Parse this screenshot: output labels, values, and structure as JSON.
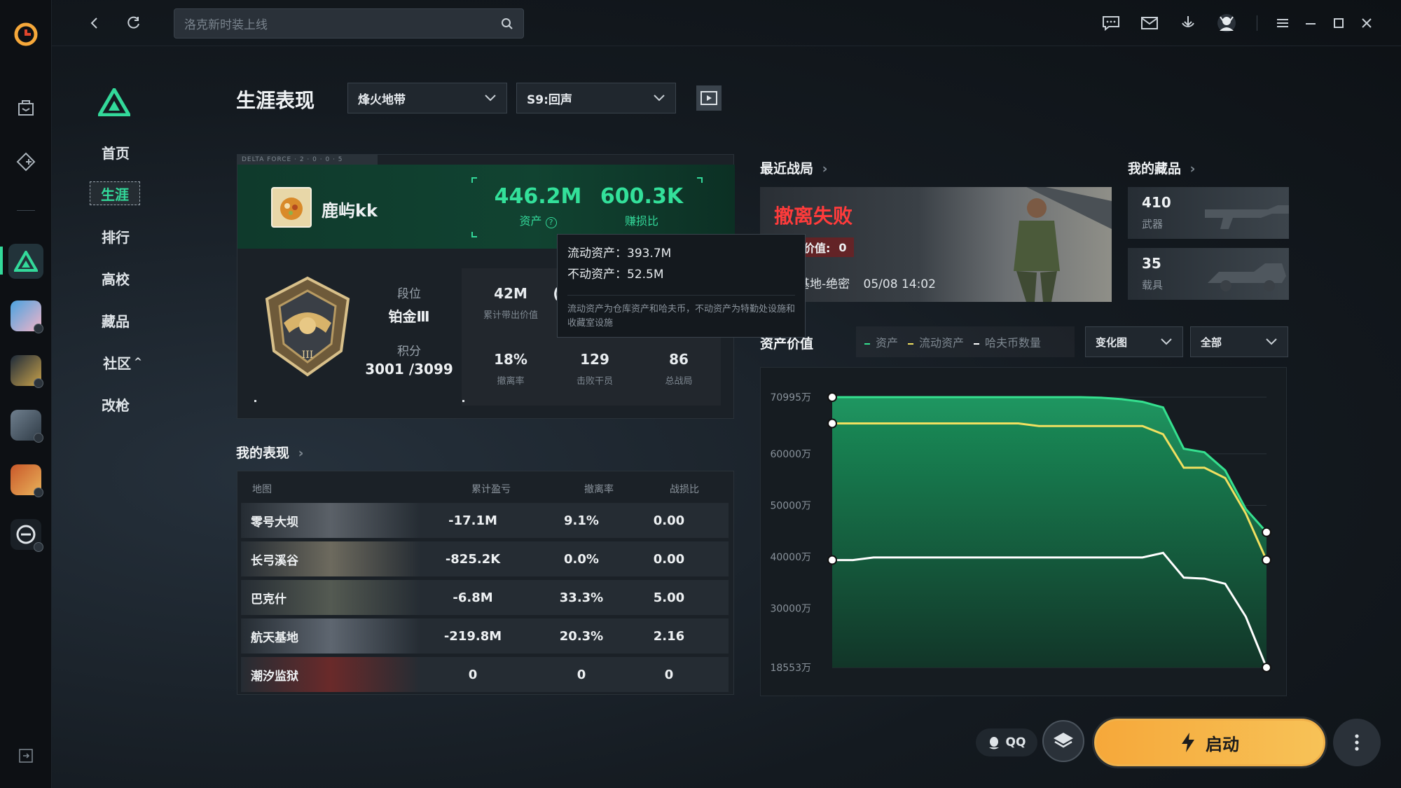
{
  "topbar": {
    "search_placeholder": "洛克新时装上线"
  },
  "left_nav": {
    "items": [
      {
        "label": "首页",
        "active": false
      },
      {
        "label": "生涯",
        "active": true
      },
      {
        "label": "排行",
        "active": false
      },
      {
        "label": "高校",
        "active": false
      },
      {
        "label": "藏品",
        "active": false
      },
      {
        "label": "社区",
        "active": false,
        "chevron": "^"
      },
      {
        "label": "改枪",
        "active": false
      }
    ]
  },
  "career": {
    "title": "生涯表现",
    "mode_dropdown": "烽火地带",
    "season_dropdown": "S9:回声",
    "card_tag": "DELTA FORCE · 2 · 0 · 0 · 5",
    "player_name": "鹿屿kk",
    "assets_value": "446.2M",
    "assets_label": "资产",
    "profit_value": "600.3K",
    "profit_label": "赚损比",
    "rank_label": "段位",
    "rank_value": "铂金Ⅲ",
    "points_label": "积分",
    "points_value": "3001 /3099",
    "stats": [
      {
        "value": "42M",
        "label": "累计带出价值"
      },
      {
        "value": "18%",
        "label": "撤离率"
      },
      {
        "value": "129",
        "label": "击败干员"
      },
      {
        "value": "86",
        "label": "总战局"
      }
    ],
    "stat_hidden_fragment": "(",
    "tooltip": {
      "liquid": "流动资产：393.7M",
      "fixed": "不动资产：52.5M",
      "note": "流动资产为仓库资产和哈夫币，不动资产为特勤处设施和收藏室设施"
    }
  },
  "performance": {
    "title": "我的表现",
    "headers": [
      "地图",
      "累计盈亏",
      "撤离率",
      "战损比"
    ],
    "rows": [
      {
        "map": "零号大坝",
        "profit": "-17.1M",
        "rate": "9.1%",
        "kd": "0.00"
      },
      {
        "map": "长弓溪谷",
        "profit": "-825.2K",
        "rate": "0.0%",
        "kd": "0.00"
      },
      {
        "map": "巴克什",
        "profit": "-6.8M",
        "rate": "33.3%",
        "kd": "5.00"
      },
      {
        "map": "航天基地",
        "profit": "-219.8M",
        "rate": "20.3%",
        "kd": "2.16"
      },
      {
        "map": "潮汐监狱",
        "profit": "0",
        "rate": "0",
        "kd": "0"
      }
    ]
  },
  "recent": {
    "title": "最近战局",
    "result": "撤离失败",
    "value_label": "带出价值:",
    "value": "0",
    "map": "航天基地-绝密",
    "time": "05/08 14:02"
  },
  "collection": {
    "title": "我的藏品",
    "weapons_count": "410",
    "weapons_label": "武器",
    "vehicles_count": "35",
    "vehicles_label": "载具"
  },
  "asset_chart": {
    "title": "资产价值",
    "legend": [
      "资产",
      "流动资产",
      "哈夫币数量"
    ],
    "view_dropdown": "变化图",
    "range_dropdown": "全部"
  },
  "chart_data": {
    "type": "area",
    "y_ticks": [
      "70995万",
      "60000万",
      "50000万",
      "40000万",
      "30000万",
      "18553万"
    ],
    "ylim": [
      18553,
      70995
    ],
    "series": [
      {
        "name": "资产",
        "color": "#35e08f",
        "values": [
          70995,
          70995,
          70995,
          70995,
          70995,
          70995,
          70995,
          70995,
          70995,
          70995,
          70995,
          70995,
          70995,
          70900,
          70600,
          70100,
          69000,
          61000,
          60300,
          56800,
          49300,
          44800
        ]
      },
      {
        "name": "流动资产",
        "color": "#f0e060",
        "values": [
          65900,
          65900,
          65900,
          65900,
          65900,
          65900,
          65900,
          65900,
          65900,
          65900,
          65400,
          65400,
          65400,
          65400,
          65400,
          65400,
          63800,
          57300,
          57300,
          55300,
          48400,
          39400
        ]
      },
      {
        "name": "哈夫币数量",
        "color": "#ffffff",
        "values": [
          39400,
          39400,
          39900,
          39900,
          39900,
          39900,
          39900,
          39900,
          39900,
          39900,
          39900,
          39900,
          39900,
          39900,
          39900,
          39900,
          40800,
          36000,
          35800,
          34800,
          28400,
          18553
        ]
      }
    ]
  },
  "bottom": {
    "qq_label": "QQ",
    "launch_label": "启动"
  },
  "colors": {
    "accent_green": "#33d99a",
    "fail_red": "#ff3b3b",
    "launch_orange": "#f6a83a"
  }
}
